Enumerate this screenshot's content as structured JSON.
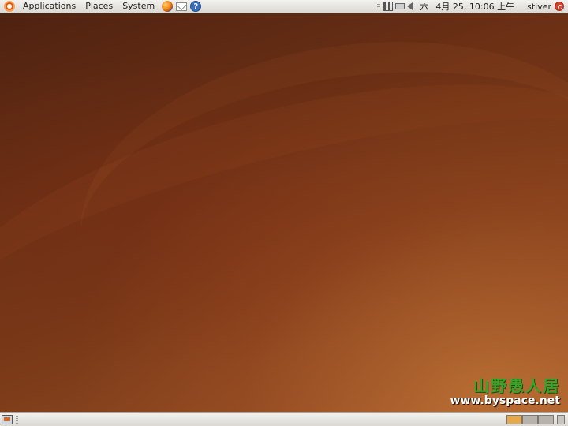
{
  "top_panel": {
    "menus": [
      "Applications",
      "Places",
      "System"
    ],
    "launchers": [
      "firefox-icon",
      "mail-icon",
      "help-icon"
    ],
    "tray_icons": [
      "network-icon",
      "battery-icon",
      "volume-icon"
    ],
    "weekday": "六",
    "clock": "4月 25, 10:06 上午",
    "user": "stiver"
  },
  "desktop": {
    "watermark_cn": "山野愚人居",
    "watermark_url": "www.byspace.net"
  },
  "bottom_panel": {
    "workspaces": [
      "active",
      "inactive",
      "inactive"
    ]
  }
}
